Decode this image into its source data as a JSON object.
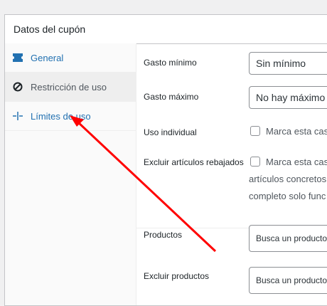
{
  "panel_title": "Datos del cupón",
  "tabs": [
    {
      "label": "General",
      "icon": "ticket-icon"
    },
    {
      "label": "Restricción de uso",
      "icon": "block-icon"
    },
    {
      "label": "Límites de uso",
      "icon": "limits-icon"
    }
  ],
  "fields": {
    "min_spend": {
      "label": "Gasto mínimo",
      "placeholder": "Sin mínimo"
    },
    "max_spend": {
      "label": "Gasto máximo",
      "placeholder": "No hay máximo"
    },
    "individual_use": {
      "label": "Uso individual",
      "checkbox_text": "Marca esta cas"
    },
    "exclude_sale": {
      "label": "Excluir artículos rebajados",
      "checkbox_text": "Marca esta cas",
      "line2": "artículos concretos",
      "line3": "completo solo func"
    },
    "products": {
      "label": "Productos",
      "placeholder": "Busca un producto"
    },
    "exclude_products": {
      "label": "Excluir productos",
      "placeholder": "Busca un producto"
    }
  },
  "colors": {
    "arrow": "#ff0000",
    "link": "#2271b1"
  }
}
